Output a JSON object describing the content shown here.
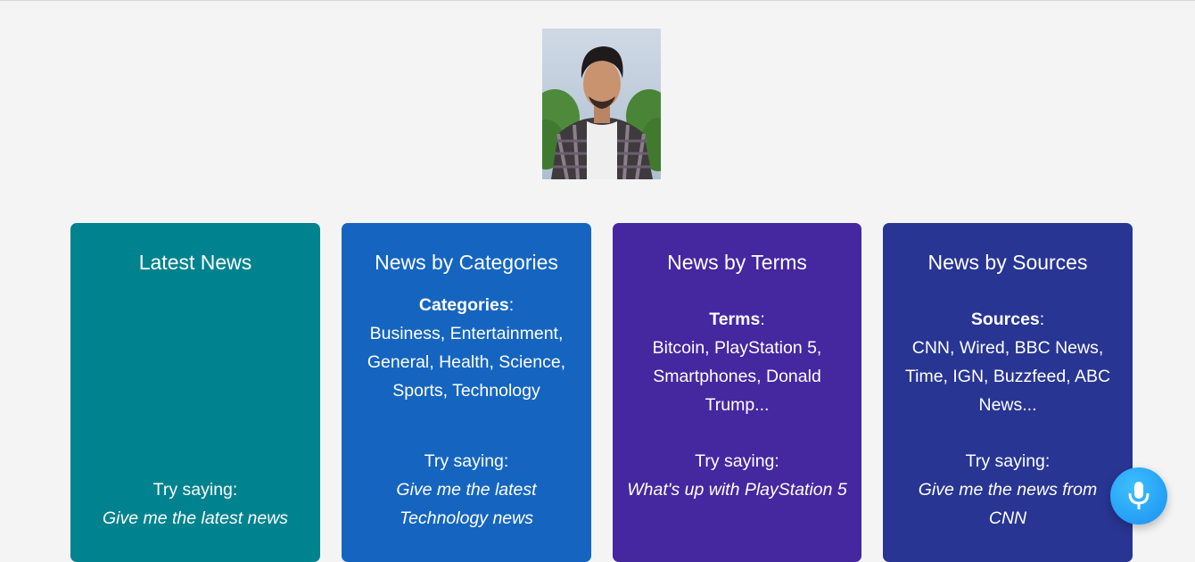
{
  "cards": [
    {
      "title": "Latest News",
      "color": "#00838f",
      "info_label": "",
      "info_text": "",
      "try_label": "Try saying:",
      "example": "Give me the latest news"
    },
    {
      "title": "News by Categories",
      "color": "#1565c0",
      "info_label": "Categories",
      "info_text": "Business, Entertainment, General, Health, Science, Sports, Technology",
      "try_label": "Try saying:",
      "example": "Give me the latest Technology news"
    },
    {
      "title": "News by Terms",
      "color": "#4527a0",
      "info_label": "Terms",
      "info_text": "Bitcoin, PlayStation 5, Smartphones, Donald Trump...",
      "try_label": "Try saying:",
      "example": "What's up with PlayStation 5"
    },
    {
      "title": "News by Sources",
      "color": "#283593",
      "info_label": "Sources",
      "info_text": "CNN, Wired, BBC News, Time, IGN, Buzzfeed, ABC News...",
      "try_label": "Try saying:",
      "example": "Give me the news from CNN"
    }
  ],
  "mic_button": {
    "icon": "microphone-icon",
    "color": "#1e9bf5"
  },
  "avatar": {
    "icon": "profile-photo"
  }
}
